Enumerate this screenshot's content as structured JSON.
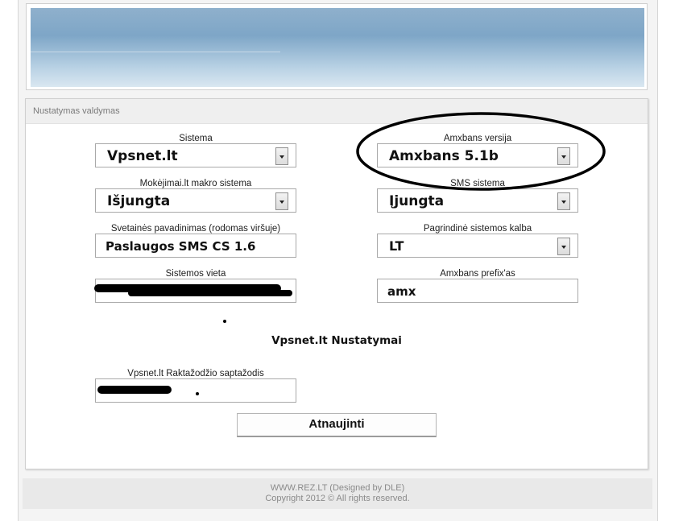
{
  "panel": {
    "title": "Nustatymas valdymas"
  },
  "fields": {
    "sistema": {
      "label": "Sistema",
      "value": "Vpsnet.lt"
    },
    "amxbans_version": {
      "label": "Amxbans versija",
      "value": "Amxbans 5.1b"
    },
    "makro_sistema": {
      "label": "Mokėjimai.lt makro sistema",
      "value": "Išjungta"
    },
    "sms_sistema": {
      "label": "SMS sistema",
      "value": "Įjungta"
    },
    "site_name": {
      "label": "Svetainės pavadinimas (rodomas viršuje)",
      "value": "Paslaugos SMS CS 1.6"
    },
    "language": {
      "label": "Pagrindinė sistemos kalba",
      "value": "LT"
    },
    "location": {
      "label": "Sistemos vieta"
    },
    "amxbans_prefix": {
      "label": "Amxbans prefix'as",
      "value": "amx"
    },
    "password": {
      "label": "Vpsnet.lt Raktažodžio saptažodis"
    }
  },
  "section": {
    "title": "Vpsnet.lt Nustatymai"
  },
  "submit_label": "Atnaujinti",
  "footer": {
    "line1": "WWW.REZ.LT (Designed by DLE)",
    "line2": "Copyright 2012 © All rights reserved."
  }
}
